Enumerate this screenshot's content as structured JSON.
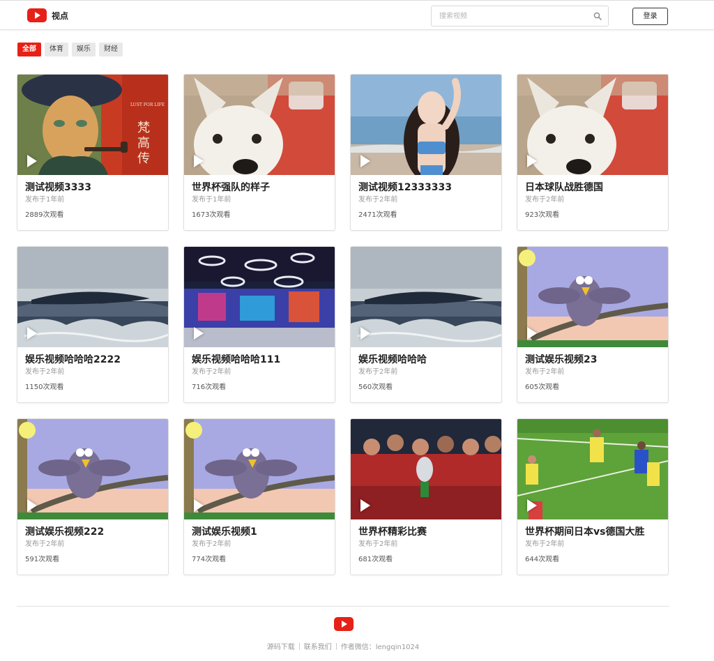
{
  "header": {
    "logo_text": "视点",
    "search_placeholder": "搜索视频",
    "login_label": "登录"
  },
  "tabs": [
    {
      "label": "全部",
      "active": true
    },
    {
      "label": "体育",
      "active": false
    },
    {
      "label": "娱乐",
      "active": false
    },
    {
      "label": "财经",
      "active": false
    }
  ],
  "videos": [
    {
      "title": "测试视频3333",
      "date": "发布于1年前",
      "views": "2889次观看",
      "thumb": "painting",
      "thumb_text": [
        "LUST FOR LIFE",
        "梵",
        "高",
        "传"
      ]
    },
    {
      "title": "世界杯强队的样子",
      "date": "发布于1年前",
      "views": "1673次观看",
      "thumb": "dog"
    },
    {
      "title": "测试视频12333333",
      "date": "发布于2年前",
      "views": "2471次观看",
      "thumb": "beach"
    },
    {
      "title": "日本球队战胜德国",
      "date": "发布于2年前",
      "views": "923次观看",
      "thumb": "dog"
    },
    {
      "title": "娱乐视频哈哈哈2222",
      "date": "发布于2年前",
      "views": "1150次观看",
      "thumb": "whale"
    },
    {
      "title": "娱乐视频哈哈哈111",
      "date": "发布于2年前",
      "views": "716次观看",
      "thumb": "club"
    },
    {
      "title": "娱乐视频哈哈哈",
      "date": "发布于2年前",
      "views": "560次观看",
      "thumb": "whale"
    },
    {
      "title": "测试娱乐视频23",
      "date": "发布于2年前",
      "views": "605次观看",
      "thumb": "bird"
    },
    {
      "title": "测试娱乐视频222",
      "date": "发布于2年前",
      "views": "591次观看",
      "thumb": "bird"
    },
    {
      "title": "测试娱乐视频1",
      "date": "发布于2年前",
      "views": "774次观看",
      "thumb": "bird"
    },
    {
      "title": "世界杯精彩比赛",
      "date": "发布于2年前",
      "views": "681次观看",
      "thumb": "team"
    },
    {
      "title": "世界杯期间日本vs德国大胜",
      "date": "发布于2年前",
      "views": "644次观看",
      "thumb": "soccer"
    }
  ],
  "footer": {
    "links": [
      "源码下载",
      "联系我们",
      "作者微信：lengqin1024"
    ]
  },
  "colors": {
    "brand": "#e62117"
  }
}
